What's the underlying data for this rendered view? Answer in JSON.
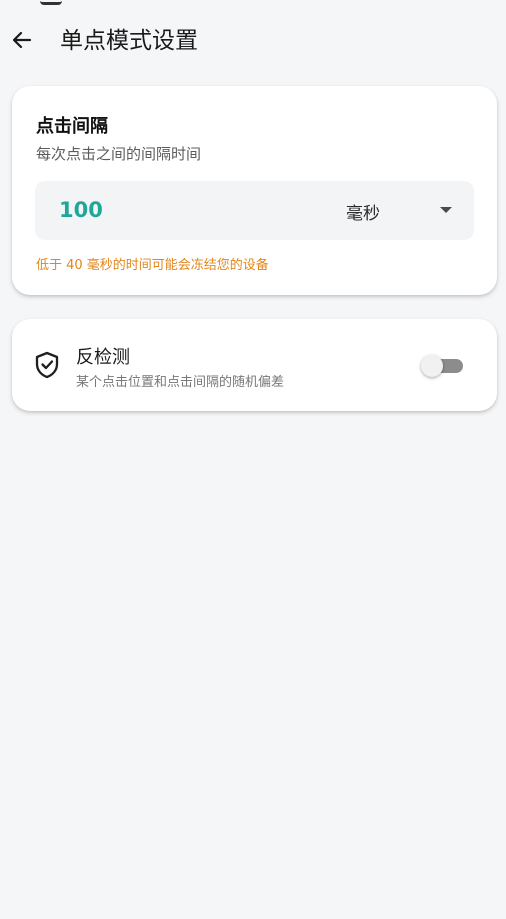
{
  "app_bar": {
    "title": "单点模式设置",
    "back_icon": "arrow-left-icon"
  },
  "interval_card": {
    "title": "点击间隔",
    "subtitle": "每次点击之间的间隔时间",
    "input_value": "100",
    "unit_selected": "毫秒",
    "unit_icon": "caret-down-icon",
    "warning": "低于 40 毫秒的时间可能会冻结您的设备",
    "value_color": "#21a79a",
    "warning_color": "#e2861b"
  },
  "anti_detection_card": {
    "icon": "shield-check-icon",
    "title": "反检测",
    "description": "某个点击位置和点击间隔的随机偏差",
    "enabled": false
  }
}
